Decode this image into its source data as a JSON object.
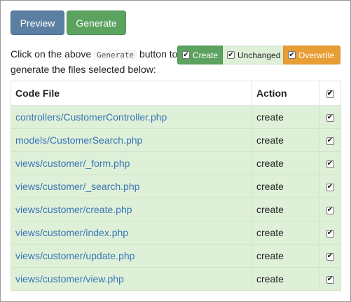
{
  "buttons": {
    "preview": "Preview",
    "generate": "Generate"
  },
  "instructions": {
    "before": "Click on the above ",
    "code": "Generate",
    "after": " button to generate the files selected below:"
  },
  "legend": {
    "create": "Create",
    "unchanged": "Unchanged",
    "overwrite": "Overwrite"
  },
  "table": {
    "headers": {
      "file": "Code File",
      "action": "Action"
    },
    "rows": [
      {
        "file": "controllers/CustomerController.php",
        "action": "create"
      },
      {
        "file": "models/CustomerSearch.php",
        "action": "create"
      },
      {
        "file": "views/customer/_form.php",
        "action": "create"
      },
      {
        "file": "views/customer/_search.php",
        "action": "create"
      },
      {
        "file": "views/customer/create.php",
        "action": "create"
      },
      {
        "file": "views/customer/index.php",
        "action": "create"
      },
      {
        "file": "views/customer/update.php",
        "action": "create"
      },
      {
        "file": "views/customer/view.php",
        "action": "create"
      }
    ]
  },
  "colors": {
    "preview_button": "#5a7fa3",
    "generate_button": "#5ba35f",
    "create_legend": "#5ba35f",
    "unchanged_legend": "#dff0d8",
    "overwrite_legend": "#e89e34",
    "row_background": "#dff0d8",
    "link": "#3875b5"
  },
  "checkbox_glyph": "✔"
}
